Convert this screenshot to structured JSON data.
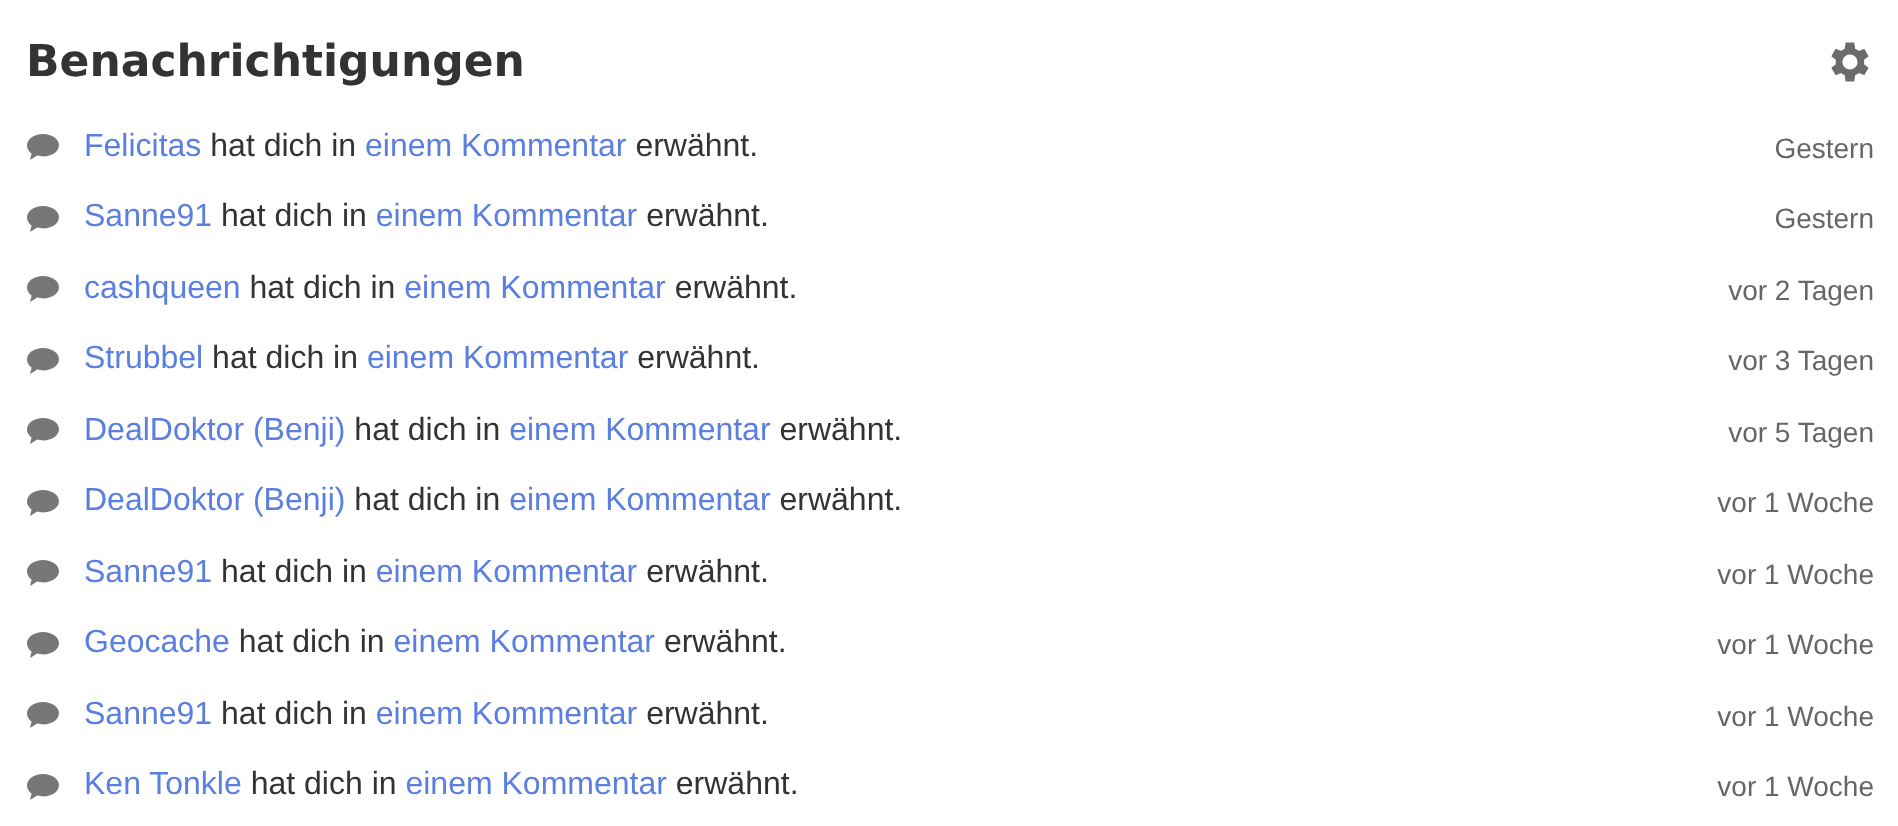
{
  "title": "Benachrichtigungen",
  "notifications": [
    {
      "user": "Felicitas",
      "before": "hat dich in",
      "link": "einem Kommentar",
      "after": "erwähnt.",
      "time": "Gestern"
    },
    {
      "user": "Sanne91",
      "before": "hat dich in",
      "link": "einem Kommentar",
      "after": "erwähnt.",
      "time": "Gestern"
    },
    {
      "user": "cashqueen",
      "before": "hat dich in",
      "link": "einem Kommentar",
      "after": "erwähnt.",
      "time": "vor 2 Tagen"
    },
    {
      "user": "Strubbel",
      "before": "hat dich in",
      "link": "einem Kommentar",
      "after": "erwähnt.",
      "time": "vor 3 Tagen"
    },
    {
      "user": "DealDoktor (Benji)",
      "before": "hat dich in",
      "link": "einem Kommentar",
      "after": "erwähnt.",
      "time": "vor 5 Tagen"
    },
    {
      "user": "DealDoktor (Benji)",
      "before": "hat dich in",
      "link": "einem Kommentar",
      "after": "erwähnt.",
      "time": "vor 1 Woche"
    },
    {
      "user": "Sanne91",
      "before": "hat dich in",
      "link": "einem Kommentar",
      "after": "erwähnt.",
      "time": "vor 1 Woche"
    },
    {
      "user": "Geocache",
      "before": "hat dich in",
      "link": "einem Kommentar",
      "after": "erwähnt.",
      "time": "vor 1 Woche"
    },
    {
      "user": "Sanne91",
      "before": "hat dich in",
      "link": "einem Kommentar",
      "after": "erwähnt.",
      "time": "vor 1 Woche"
    },
    {
      "user": "Ken Tonkle",
      "before": "hat dich in",
      "link": "einem Kommentar",
      "after": "erwähnt.",
      "time": "vor 1 Woche"
    }
  ]
}
